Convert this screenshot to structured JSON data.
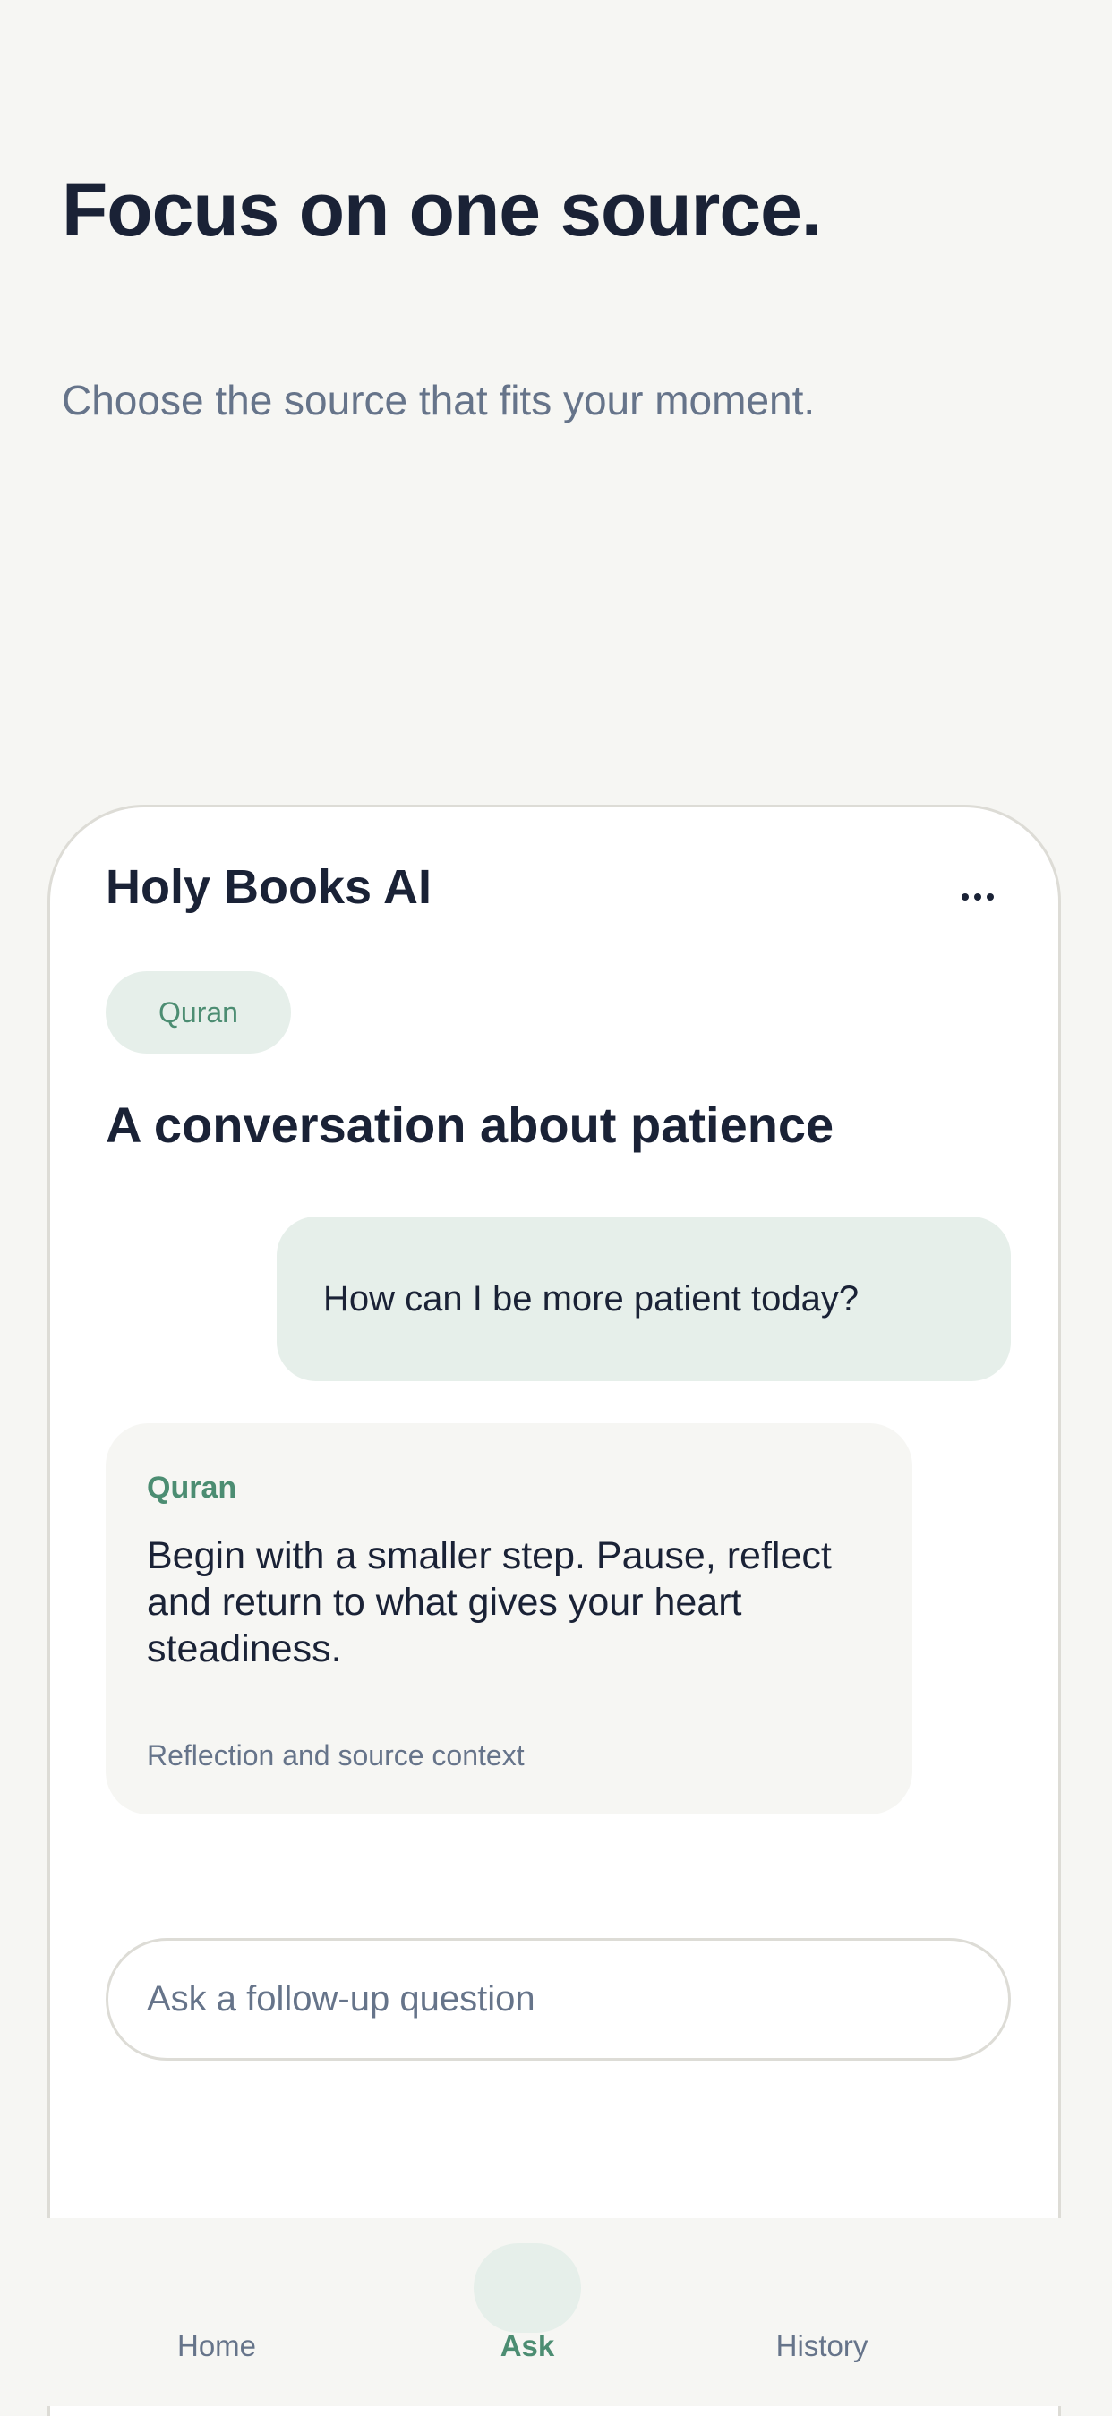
{
  "hero": {
    "title": "Focus on one source.",
    "subtitle": "Choose the source that fits your moment."
  },
  "card": {
    "app_title": "Holy Books AI",
    "more_icon": "more-horizontal-icon",
    "source_chip": "Quran",
    "conversation_title": "A conversation about patience",
    "user_message": "How can I be more patient today?",
    "reply": {
      "source": "Quran",
      "text": "Begin with a smaller step. Pause, reflect and return to what gives your heart steadiness.",
      "context": "Reflection and source context"
    },
    "followup": {
      "placeholder": "Ask a follow-up question",
      "value": ""
    }
  },
  "tabs": {
    "active": "Ask",
    "items": [
      {
        "label": "Home"
      },
      {
        "label": "Ask"
      },
      {
        "label": "History"
      }
    ]
  },
  "colors": {
    "background": "#f6f6f3",
    "text_primary": "#1a2236",
    "text_muted": "#66748a",
    "accent_green": "#4c8d72",
    "accent_tint": "#e6efea",
    "card_border": "#dddcd6"
  }
}
